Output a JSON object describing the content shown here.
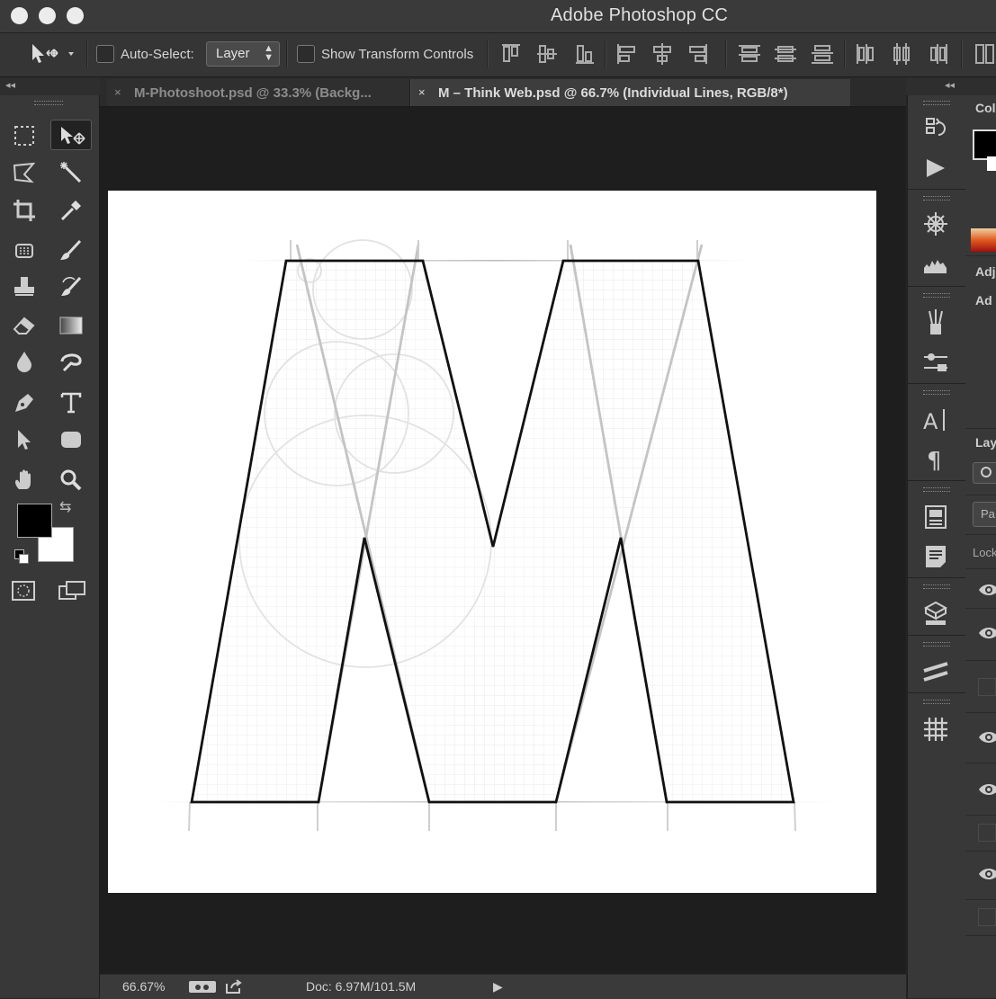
{
  "app": {
    "title": "Adobe Photoshop CC"
  },
  "options": {
    "auto_select_label": "Auto-Select:",
    "auto_select_value": "Layer",
    "show_transform_label": "Show Transform Controls"
  },
  "tabs": [
    {
      "label": "M-Photoshoot.psd @ 33.3% (Backg...",
      "close": "×"
    },
    {
      "label": "M – Think Web.psd @ 66.7% (Individual Lines, RGB/8*)",
      "close": "×"
    }
  ],
  "status": {
    "zoom": "66.67%",
    "doc": "Doc: 6.97M/101.5M"
  },
  "panels": {
    "color_label": "Col",
    "adjust_label1": "Adj",
    "adjust_label2": "Ad",
    "layers_label": "Lay",
    "kind_label": "Pa",
    "lock_label": "Lock"
  },
  "icons": {
    "move": "move-tool-icon",
    "marquee": "marquee-icon",
    "lasso": "lasso-icon",
    "magic_wand": "magic-wand-icon",
    "crop": "crop-icon",
    "eyedropper": "eyedropper-icon",
    "heal": "healing-brush-icon",
    "brush": "brush-icon",
    "stamp": "clone-stamp-icon",
    "history_brush": "history-brush-icon",
    "eraser": "eraser-icon",
    "gradient": "gradient-icon",
    "blur": "blur-icon",
    "dodge": "dodge-icon",
    "pen": "pen-icon",
    "type": "type-icon",
    "path_select": "path-selection-icon",
    "shape": "rounded-rectangle-icon",
    "hand": "hand-icon",
    "zoom": "zoom-icon"
  },
  "colors": {
    "foreground": "#000000",
    "background": "#ffffff",
    "ui_dark": "#262626",
    "panel": "#383838"
  }
}
